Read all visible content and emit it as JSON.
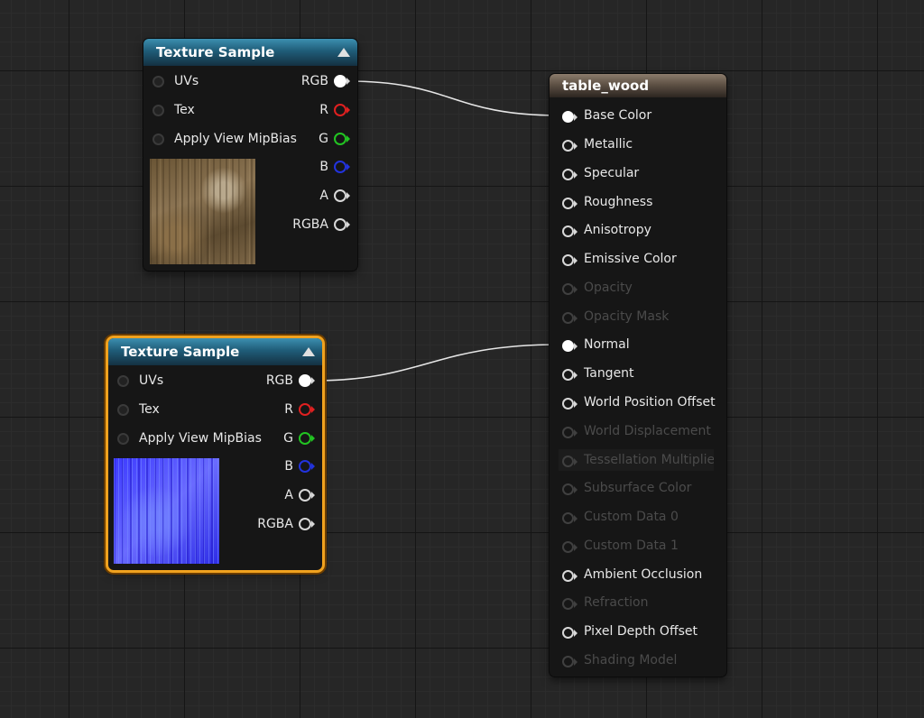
{
  "nodes": {
    "texture_sample_1": {
      "title": "Texture Sample",
      "inputs": [
        "UVs",
        "Tex",
        "Apply View MipBias"
      ],
      "outputs": [
        "RGB",
        "R",
        "G",
        "B",
        "A",
        "RGBA"
      ],
      "preview": "wood-texture-thumbnail"
    },
    "texture_sample_2": {
      "title": "Texture Sample",
      "selected": true,
      "inputs": [
        "UVs",
        "Tex",
        "Apply View MipBias"
      ],
      "outputs": [
        "RGB",
        "R",
        "G",
        "B",
        "A",
        "RGBA"
      ],
      "preview": "normal-map-thumbnail"
    },
    "material": {
      "title": "table_wood",
      "inputs": [
        {
          "label": "Base Color",
          "enabled": true,
          "connected": true
        },
        {
          "label": "Metallic",
          "enabled": true
        },
        {
          "label": "Specular",
          "enabled": true
        },
        {
          "label": "Roughness",
          "enabled": true
        },
        {
          "label": "Anisotropy",
          "enabled": true
        },
        {
          "label": "Emissive Color",
          "enabled": true
        },
        {
          "label": "Opacity",
          "enabled": false
        },
        {
          "label": "Opacity Mask",
          "enabled": false
        },
        {
          "label": "Normal",
          "enabled": true,
          "connected": true
        },
        {
          "label": "Tangent",
          "enabled": true
        },
        {
          "label": "World Position Offset",
          "enabled": true
        },
        {
          "label": "World Displacement",
          "enabled": false
        },
        {
          "label": "Tessellation Multiplier",
          "enabled": false
        },
        {
          "label": "Subsurface Color",
          "enabled": false
        },
        {
          "label": "Custom Data 0",
          "enabled": false
        },
        {
          "label": "Custom Data 1",
          "enabled": false
        },
        {
          "label": "Ambient Occlusion",
          "enabled": true
        },
        {
          "label": "Refraction",
          "enabled": false
        },
        {
          "label": "Pixel Depth Offset",
          "enabled": true
        },
        {
          "label": "Shading Model",
          "enabled": false
        }
      ]
    }
  },
  "pin_colors": {
    "R": "#e02020",
    "G": "#22c422",
    "B": "#2233dd",
    "default": "#d8d8d8"
  },
  "accent": {
    "selection": "#f0a21f"
  }
}
